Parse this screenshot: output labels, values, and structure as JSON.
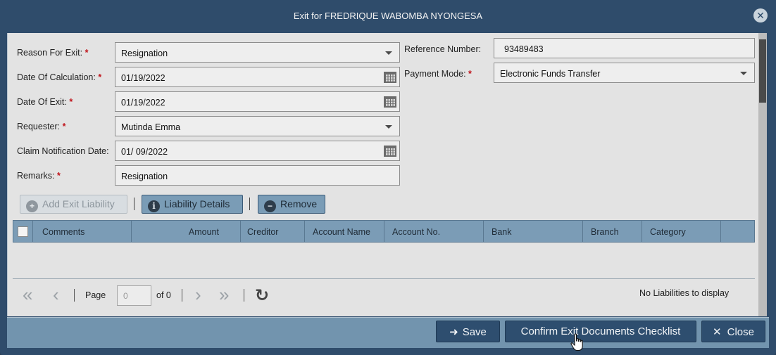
{
  "dialog": {
    "title": "Exit for FREDRIQUE WABOMBA NYONGESA"
  },
  "form": {
    "reason_label": "Reason For Exit:",
    "reason_value": "Resignation",
    "calc_date_label": "Date Of Calculation:",
    "calc_date_value": "01/19/2022",
    "exit_date_label": "Date Of Exit:",
    "exit_date_value": "01/19/2022",
    "requester_label": "Requester:",
    "requester_value": "Mutinda Emma",
    "claim_date_label": "Claim Notification Date:",
    "claim_date_value": "01/ 09/2022",
    "remarks_label": "Remarks:",
    "remarks_value": "Resignation",
    "ref_label": "Reference Number:",
    "ref_value": "93489483",
    "payment_label": "Payment Mode:",
    "payment_value": "Electronic Funds Transfer",
    "required_mark": "*"
  },
  "toolbar": {
    "add_label": "Add Exit Liability",
    "details_label": "Liability Details",
    "remove_label": "Remove"
  },
  "grid": {
    "columns": [
      "Comments",
      "Amount",
      "Creditor",
      "Account Name",
      "Account No.",
      "Bank",
      "Branch",
      "Category"
    ]
  },
  "pager": {
    "page_label": "Page",
    "page_value": "0",
    "of_label": "of 0",
    "empty_message": "No Liabilities to display"
  },
  "footer": {
    "save_label": "Save",
    "confirm_label": "Confirm Exit Documents Checklist",
    "close_label": "Close"
  },
  "icons": {
    "close": "close-icon",
    "calendar": "calendar-icon",
    "dropdown": "chevron-down-icon",
    "add": "plus-circle-icon",
    "info": "info-icon",
    "remove": "minus-circle-icon",
    "first": "first-page-icon",
    "prev": "prev-page-icon",
    "next": "next-page-icon",
    "last": "last-page-icon",
    "refresh": "refresh-icon",
    "save": "save-icon",
    "cursor": "hand-cursor-icon"
  }
}
